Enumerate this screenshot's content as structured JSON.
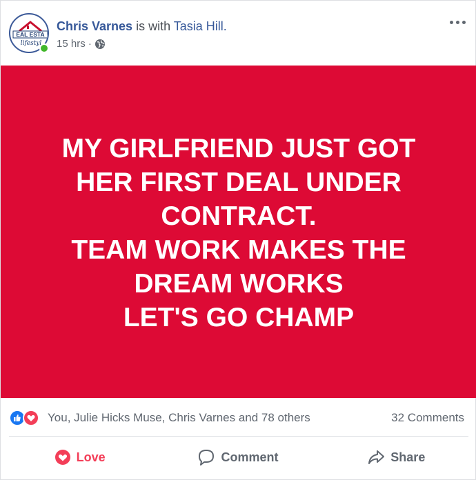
{
  "post": {
    "author_name": "Chris Varnes",
    "with_text": "is with",
    "tagged_name": "Tasia Hill.",
    "timestamp": "15 hrs ·",
    "privacy_icon": "globe-icon",
    "avatar_text_1": "EAL ESTA",
    "avatar_text_2": "lifestyl",
    "more_icon": "ellipsis-icon"
  },
  "image_text": {
    "lines": [
      "MY GIRLFRIEND JUST GOT",
      "HER FIRST DEAL UNDER",
      "CONTRACT.",
      "TEAM WORK MAKES THE",
      "DREAM WORKS",
      "LET'S GO CHAMP"
    ],
    "background_color": "#dd0a35",
    "text_color": "#ffffff"
  },
  "reactions": {
    "icons": [
      "like-icon",
      "love-icon"
    ],
    "reactors_text": "You, Julie Hicks Muse, Chris Varnes and 78 others",
    "comments_text": "32 Comments"
  },
  "actions": {
    "love_label": "Love",
    "comment_label": "Comment",
    "share_label": "Share"
  },
  "colors": {
    "link": "#365899",
    "love": "#f33e58",
    "like": "#1877f2",
    "online": "#42b72a"
  }
}
